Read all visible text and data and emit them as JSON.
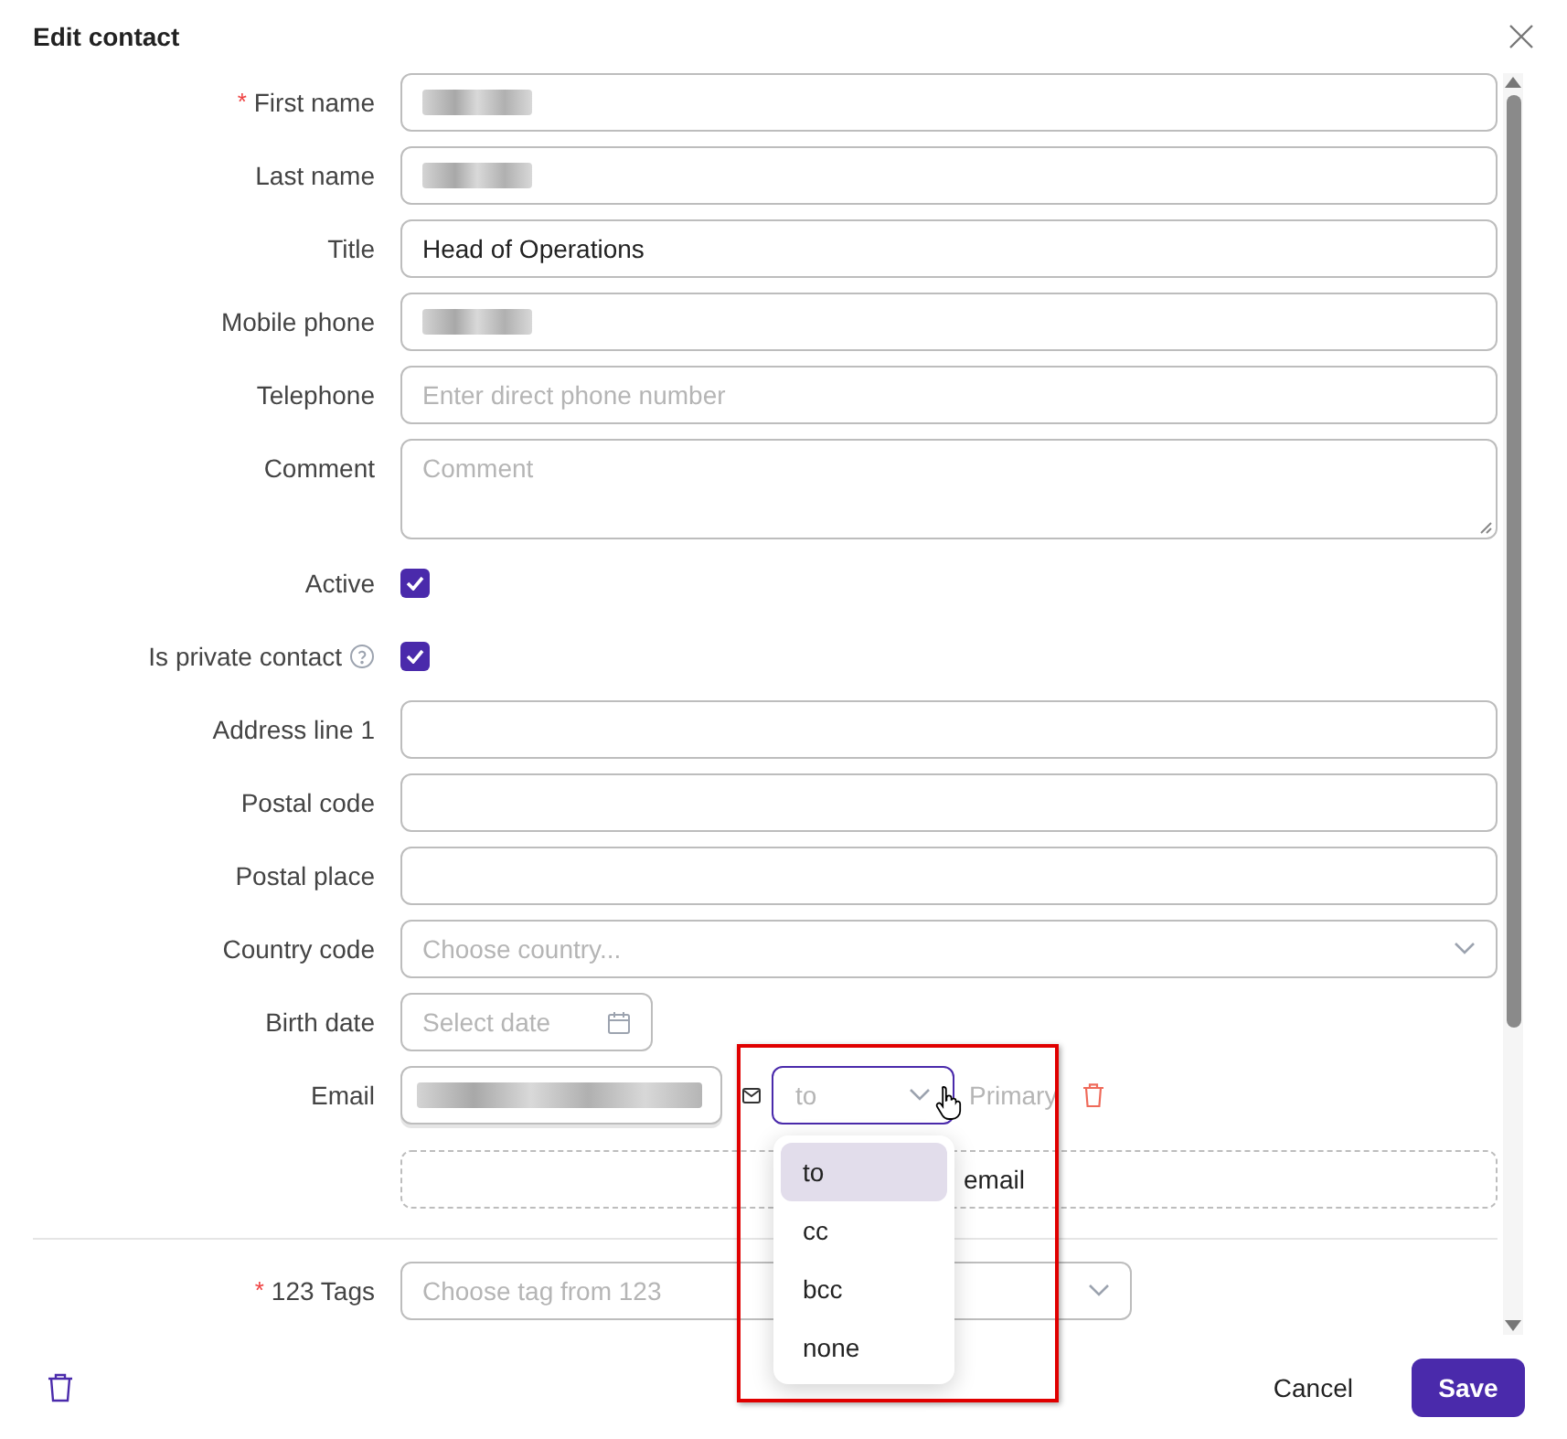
{
  "dialog": {
    "title": "Edit contact"
  },
  "fields": [
    {
      "kind": "text",
      "label": "First name",
      "required_mark": "*",
      "redacted": true
    },
    {
      "kind": "text",
      "label": "Last name",
      "redacted": true
    },
    {
      "kind": "text",
      "label": "Title",
      "value": "Head of Operations"
    },
    {
      "kind": "text",
      "label": "Mobile phone",
      "redacted": true
    },
    {
      "kind": "text",
      "label": "Telephone",
      "placeholder": "Enter direct phone number"
    },
    {
      "kind": "textarea",
      "label": "Comment",
      "placeholder": "Comment"
    },
    {
      "kind": "checkbox",
      "label": "Active",
      "checked": true
    },
    {
      "kind": "checkbox",
      "label": "Is private contact",
      "checked": true,
      "help": true
    },
    {
      "kind": "text",
      "label": "Address line 1"
    },
    {
      "kind": "text",
      "label": "Postal code"
    },
    {
      "kind": "text",
      "label": "Postal place"
    },
    {
      "kind": "select",
      "label": "Country code",
      "placeholder": "Choose country..."
    },
    {
      "kind": "date",
      "label": "Birth date",
      "placeholder": "Select date"
    },
    {
      "kind": "email",
      "label": "Email",
      "redacted": true,
      "recipient_placeholder": "to",
      "primary": "Primary",
      "expanded": true,
      "options": [
        {
          "label": "to",
          "selected": true
        },
        {
          "label": "cc",
          "selected": false
        },
        {
          "label": "bcc",
          "selected": false
        },
        {
          "label": "none",
          "selected": false
        }
      ],
      "add_button": "email"
    },
    {
      "kind": "divider"
    },
    {
      "kind": "select_short",
      "label": "123 Tags",
      "required_mark": "*",
      "placeholder": "Choose tag from 123"
    }
  ],
  "footer": {
    "cancel": "Cancel",
    "save": "Save"
  }
}
